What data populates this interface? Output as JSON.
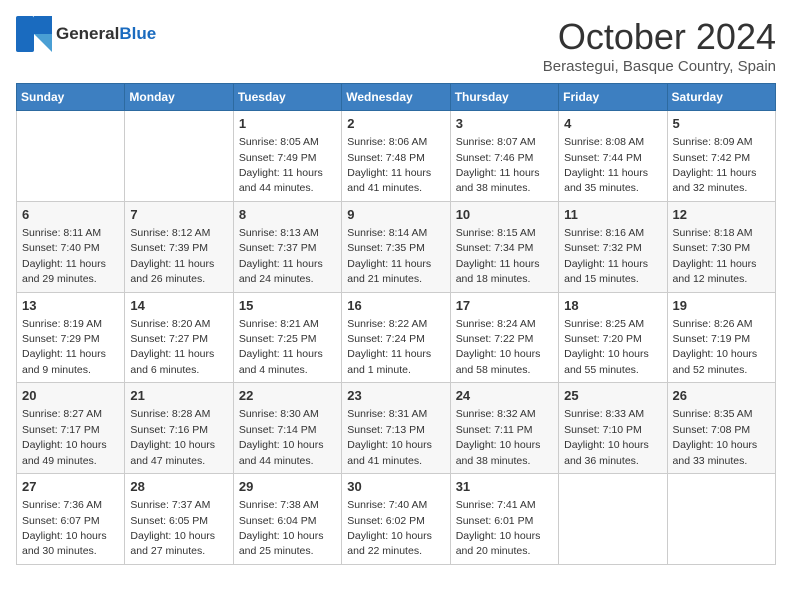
{
  "header": {
    "logo": {
      "general": "General",
      "blue": "Blue"
    },
    "title": "October 2024",
    "location": "Berastegui, Basque Country, Spain"
  },
  "weekdays": [
    "Sunday",
    "Monday",
    "Tuesday",
    "Wednesday",
    "Thursday",
    "Friday",
    "Saturday"
  ],
  "weeks": [
    [
      {
        "day": "",
        "info": ""
      },
      {
        "day": "",
        "info": ""
      },
      {
        "day": "1",
        "info": "Sunrise: 8:05 AM\nSunset: 7:49 PM\nDaylight: 11 hours and 44 minutes."
      },
      {
        "day": "2",
        "info": "Sunrise: 8:06 AM\nSunset: 7:48 PM\nDaylight: 11 hours and 41 minutes."
      },
      {
        "day": "3",
        "info": "Sunrise: 8:07 AM\nSunset: 7:46 PM\nDaylight: 11 hours and 38 minutes."
      },
      {
        "day": "4",
        "info": "Sunrise: 8:08 AM\nSunset: 7:44 PM\nDaylight: 11 hours and 35 minutes."
      },
      {
        "day": "5",
        "info": "Sunrise: 8:09 AM\nSunset: 7:42 PM\nDaylight: 11 hours and 32 minutes."
      }
    ],
    [
      {
        "day": "6",
        "info": "Sunrise: 8:11 AM\nSunset: 7:40 PM\nDaylight: 11 hours and 29 minutes."
      },
      {
        "day": "7",
        "info": "Sunrise: 8:12 AM\nSunset: 7:39 PM\nDaylight: 11 hours and 26 minutes."
      },
      {
        "day": "8",
        "info": "Sunrise: 8:13 AM\nSunset: 7:37 PM\nDaylight: 11 hours and 24 minutes."
      },
      {
        "day": "9",
        "info": "Sunrise: 8:14 AM\nSunset: 7:35 PM\nDaylight: 11 hours and 21 minutes."
      },
      {
        "day": "10",
        "info": "Sunrise: 8:15 AM\nSunset: 7:34 PM\nDaylight: 11 hours and 18 minutes."
      },
      {
        "day": "11",
        "info": "Sunrise: 8:16 AM\nSunset: 7:32 PM\nDaylight: 11 hours and 15 minutes."
      },
      {
        "day": "12",
        "info": "Sunrise: 8:18 AM\nSunset: 7:30 PM\nDaylight: 11 hours and 12 minutes."
      }
    ],
    [
      {
        "day": "13",
        "info": "Sunrise: 8:19 AM\nSunset: 7:29 PM\nDaylight: 11 hours and 9 minutes."
      },
      {
        "day": "14",
        "info": "Sunrise: 8:20 AM\nSunset: 7:27 PM\nDaylight: 11 hours and 6 minutes."
      },
      {
        "day": "15",
        "info": "Sunrise: 8:21 AM\nSunset: 7:25 PM\nDaylight: 11 hours and 4 minutes."
      },
      {
        "day": "16",
        "info": "Sunrise: 8:22 AM\nSunset: 7:24 PM\nDaylight: 11 hours and 1 minute."
      },
      {
        "day": "17",
        "info": "Sunrise: 8:24 AM\nSunset: 7:22 PM\nDaylight: 10 hours and 58 minutes."
      },
      {
        "day": "18",
        "info": "Sunrise: 8:25 AM\nSunset: 7:20 PM\nDaylight: 10 hours and 55 minutes."
      },
      {
        "day": "19",
        "info": "Sunrise: 8:26 AM\nSunset: 7:19 PM\nDaylight: 10 hours and 52 minutes."
      }
    ],
    [
      {
        "day": "20",
        "info": "Sunrise: 8:27 AM\nSunset: 7:17 PM\nDaylight: 10 hours and 49 minutes."
      },
      {
        "day": "21",
        "info": "Sunrise: 8:28 AM\nSunset: 7:16 PM\nDaylight: 10 hours and 47 minutes."
      },
      {
        "day": "22",
        "info": "Sunrise: 8:30 AM\nSunset: 7:14 PM\nDaylight: 10 hours and 44 minutes."
      },
      {
        "day": "23",
        "info": "Sunrise: 8:31 AM\nSunset: 7:13 PM\nDaylight: 10 hours and 41 minutes."
      },
      {
        "day": "24",
        "info": "Sunrise: 8:32 AM\nSunset: 7:11 PM\nDaylight: 10 hours and 38 minutes."
      },
      {
        "day": "25",
        "info": "Sunrise: 8:33 AM\nSunset: 7:10 PM\nDaylight: 10 hours and 36 minutes."
      },
      {
        "day": "26",
        "info": "Sunrise: 8:35 AM\nSunset: 7:08 PM\nDaylight: 10 hours and 33 minutes."
      }
    ],
    [
      {
        "day": "27",
        "info": "Sunrise: 7:36 AM\nSunset: 6:07 PM\nDaylight: 10 hours and 30 minutes."
      },
      {
        "day": "28",
        "info": "Sunrise: 7:37 AM\nSunset: 6:05 PM\nDaylight: 10 hours and 27 minutes."
      },
      {
        "day": "29",
        "info": "Sunrise: 7:38 AM\nSunset: 6:04 PM\nDaylight: 10 hours and 25 minutes."
      },
      {
        "day": "30",
        "info": "Sunrise: 7:40 AM\nSunset: 6:02 PM\nDaylight: 10 hours and 22 minutes."
      },
      {
        "day": "31",
        "info": "Sunrise: 7:41 AM\nSunset: 6:01 PM\nDaylight: 10 hours and 20 minutes."
      },
      {
        "day": "",
        "info": ""
      },
      {
        "day": "",
        "info": ""
      }
    ]
  ]
}
